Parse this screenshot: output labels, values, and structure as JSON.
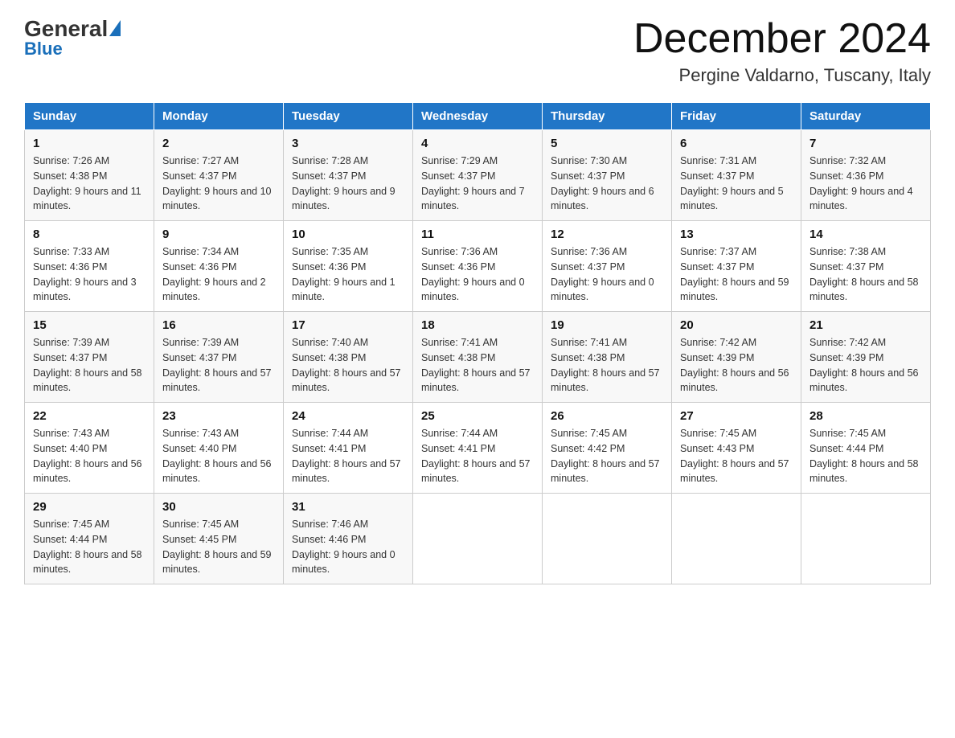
{
  "header": {
    "logo": {
      "general": "General",
      "blue": "Blue"
    },
    "title": "December 2024",
    "location": "Pergine Valdarno, Tuscany, Italy"
  },
  "days_of_week": [
    "Sunday",
    "Monday",
    "Tuesday",
    "Wednesday",
    "Thursday",
    "Friday",
    "Saturday"
  ],
  "weeks": [
    [
      {
        "day": "1",
        "sunrise": "7:26 AM",
        "sunset": "4:38 PM",
        "daylight": "9 hours and 11 minutes."
      },
      {
        "day": "2",
        "sunrise": "7:27 AM",
        "sunset": "4:37 PM",
        "daylight": "9 hours and 10 minutes."
      },
      {
        "day": "3",
        "sunrise": "7:28 AM",
        "sunset": "4:37 PM",
        "daylight": "9 hours and 9 minutes."
      },
      {
        "day": "4",
        "sunrise": "7:29 AM",
        "sunset": "4:37 PM",
        "daylight": "9 hours and 7 minutes."
      },
      {
        "day": "5",
        "sunrise": "7:30 AM",
        "sunset": "4:37 PM",
        "daylight": "9 hours and 6 minutes."
      },
      {
        "day": "6",
        "sunrise": "7:31 AM",
        "sunset": "4:37 PM",
        "daylight": "9 hours and 5 minutes."
      },
      {
        "day": "7",
        "sunrise": "7:32 AM",
        "sunset": "4:36 PM",
        "daylight": "9 hours and 4 minutes."
      }
    ],
    [
      {
        "day": "8",
        "sunrise": "7:33 AM",
        "sunset": "4:36 PM",
        "daylight": "9 hours and 3 minutes."
      },
      {
        "day": "9",
        "sunrise": "7:34 AM",
        "sunset": "4:36 PM",
        "daylight": "9 hours and 2 minutes."
      },
      {
        "day": "10",
        "sunrise": "7:35 AM",
        "sunset": "4:36 PM",
        "daylight": "9 hours and 1 minute."
      },
      {
        "day": "11",
        "sunrise": "7:36 AM",
        "sunset": "4:36 PM",
        "daylight": "9 hours and 0 minutes."
      },
      {
        "day": "12",
        "sunrise": "7:36 AM",
        "sunset": "4:37 PM",
        "daylight": "9 hours and 0 minutes."
      },
      {
        "day": "13",
        "sunrise": "7:37 AM",
        "sunset": "4:37 PM",
        "daylight": "8 hours and 59 minutes."
      },
      {
        "day": "14",
        "sunrise": "7:38 AM",
        "sunset": "4:37 PM",
        "daylight": "8 hours and 58 minutes."
      }
    ],
    [
      {
        "day": "15",
        "sunrise": "7:39 AM",
        "sunset": "4:37 PM",
        "daylight": "8 hours and 58 minutes."
      },
      {
        "day": "16",
        "sunrise": "7:39 AM",
        "sunset": "4:37 PM",
        "daylight": "8 hours and 57 minutes."
      },
      {
        "day": "17",
        "sunrise": "7:40 AM",
        "sunset": "4:38 PM",
        "daylight": "8 hours and 57 minutes."
      },
      {
        "day": "18",
        "sunrise": "7:41 AM",
        "sunset": "4:38 PM",
        "daylight": "8 hours and 57 minutes."
      },
      {
        "day": "19",
        "sunrise": "7:41 AM",
        "sunset": "4:38 PM",
        "daylight": "8 hours and 57 minutes."
      },
      {
        "day": "20",
        "sunrise": "7:42 AM",
        "sunset": "4:39 PM",
        "daylight": "8 hours and 56 minutes."
      },
      {
        "day": "21",
        "sunrise": "7:42 AM",
        "sunset": "4:39 PM",
        "daylight": "8 hours and 56 minutes."
      }
    ],
    [
      {
        "day": "22",
        "sunrise": "7:43 AM",
        "sunset": "4:40 PM",
        "daylight": "8 hours and 56 minutes."
      },
      {
        "day": "23",
        "sunrise": "7:43 AM",
        "sunset": "4:40 PM",
        "daylight": "8 hours and 56 minutes."
      },
      {
        "day": "24",
        "sunrise": "7:44 AM",
        "sunset": "4:41 PM",
        "daylight": "8 hours and 57 minutes."
      },
      {
        "day": "25",
        "sunrise": "7:44 AM",
        "sunset": "4:41 PM",
        "daylight": "8 hours and 57 minutes."
      },
      {
        "day": "26",
        "sunrise": "7:45 AM",
        "sunset": "4:42 PM",
        "daylight": "8 hours and 57 minutes."
      },
      {
        "day": "27",
        "sunrise": "7:45 AM",
        "sunset": "4:43 PM",
        "daylight": "8 hours and 57 minutes."
      },
      {
        "day": "28",
        "sunrise": "7:45 AM",
        "sunset": "4:44 PM",
        "daylight": "8 hours and 58 minutes."
      }
    ],
    [
      {
        "day": "29",
        "sunrise": "7:45 AM",
        "sunset": "4:44 PM",
        "daylight": "8 hours and 58 minutes."
      },
      {
        "day": "30",
        "sunrise": "7:45 AM",
        "sunset": "4:45 PM",
        "daylight": "8 hours and 59 minutes."
      },
      {
        "day": "31",
        "sunrise": "7:46 AM",
        "sunset": "4:46 PM",
        "daylight": "9 hours and 0 minutes."
      },
      null,
      null,
      null,
      null
    ]
  ],
  "labels": {
    "sunrise": "Sunrise:",
    "sunset": "Sunset:",
    "daylight": "Daylight:"
  }
}
